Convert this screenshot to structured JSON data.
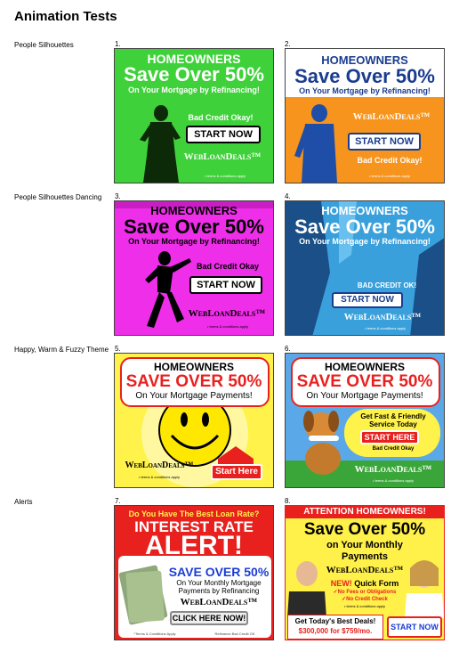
{
  "page": {
    "title": "Animation Tests"
  },
  "rows": [
    {
      "label": "People Silhouettes"
    },
    {
      "label": "People Silhouettes Dancing"
    },
    {
      "label": "Happy, Warm & Fuzzy Theme"
    },
    {
      "label": "Alerts"
    }
  ],
  "ads": {
    "a1": {
      "num": "1.",
      "headline": "HOMEOWNERS",
      "save": "Save Over 50%",
      "sub": "On Your Mortgage by Refinancing!",
      "credit": "Bad Credit Okay!",
      "cta": "START NOW",
      "logo": "WebLoanDeals™",
      "terms": "• terms & conditions apply",
      "bg": "#3fd13a"
    },
    "a2": {
      "num": "2.",
      "headline": "HOMEOWNERS",
      "save": "Save Over 50%",
      "sub": "On Your Mortgage by Refinancing!",
      "credit": "Bad Credit Okay!",
      "cta": "START NOW",
      "logo": "WebLoanDeals™",
      "terms": "• terms & conditions apply",
      "bg": "#f7941d"
    },
    "a3": {
      "num": "3.",
      "headline": "HOMEOWNERS",
      "save": "Save Over 50%",
      "sub": "On Your Mortgage by Refinancing!",
      "credit": "Bad Credit Okay",
      "cta": "START NOW",
      "logo": "WebLoanDeals™",
      "terms": "• terms & conditions apply",
      "bg": "#ee2ee8"
    },
    "a4": {
      "num": "4.",
      "headline": "HOMEOWNERS",
      "save": "Save Over 50%",
      "sub": "On Your Mortgage by Refinancing!",
      "credit": "BAD CREDIT OK!",
      "cta": "START NOW",
      "logo": "WebLoanDeals™",
      "terms": "• terms & conditions apply",
      "bg": "#3aa0dc"
    },
    "a5": {
      "num": "5.",
      "headline": "HOMEOWNERS",
      "save": "SAVE OVER 50%",
      "sub": "On Your Mortgage Payments!",
      "cta": "Start Here",
      "logo": "WebLoanDeals™",
      "terms": "• terms & conditions apply",
      "bg": "#fff24a"
    },
    "a6": {
      "num": "6.",
      "headline": "HOMEOWNERS",
      "save": "SAVE OVER 50%",
      "sub": "On Your Mortgage Payments!",
      "service1": "Get Fast & Friendly",
      "service2": "Service Today",
      "cta": "START HERE",
      "credit": "Bad Credit Okay",
      "logo": "WebLoanDeals™",
      "terms": "• terms & conditions apply",
      "bg": "#5aa8e8"
    },
    "a7": {
      "num": "7.",
      "question": "Do You Have The Best Loan Rate?",
      "line1": "INTEREST RATE",
      "line2": "ALERT!",
      "save": "SAVE OVER 50%",
      "sub1": "On Your Monthly Mortgage",
      "sub2": "Payments by Refinancing",
      "logo": "WebLoanDeals™",
      "cta": "CLICK HERE NOW!",
      "terms": "*Terms & Conditions Apply",
      "credit": "Refinance Bad Credit OK",
      "bg": "#e8211f"
    },
    "a8": {
      "num": "8.",
      "top": "ATTENTION HOMEOWNERS!",
      "save": "Save Over 50%",
      "sub1": "on Your Monthly",
      "sub2": "Payments",
      "logo": "WebLoanDeals™",
      "quick_new": "NEW!",
      "quick": "Quick Form",
      "check1": "✓No Fees or Obligations",
      "check2": "✓No Credit Check",
      "terms": "• terms & conditions apply",
      "deal1": "Get Today's Best Deals!",
      "deal2": "$300,000 for $759/mo.",
      "cta": "START NOW",
      "bg": "#fff04a"
    }
  }
}
